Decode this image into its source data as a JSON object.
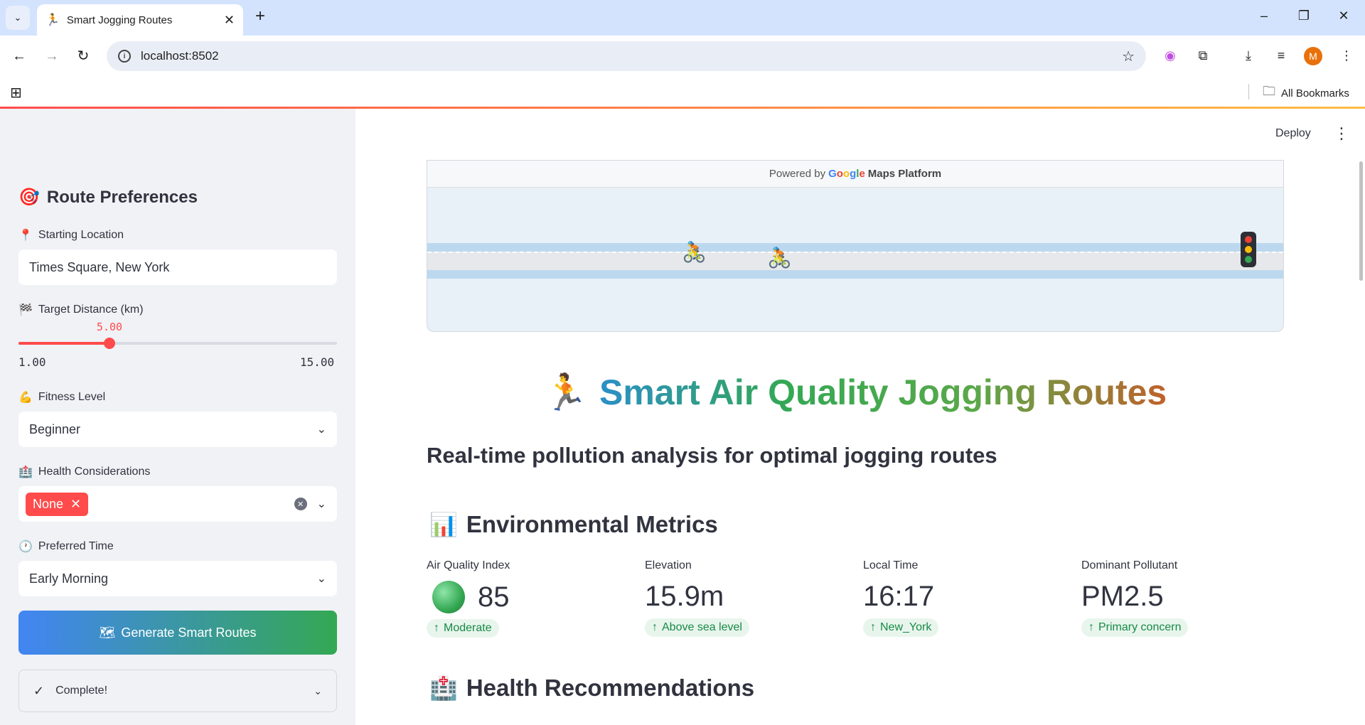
{
  "browser": {
    "tab_title": "Smart Jogging Routes",
    "url": "localhost:8502",
    "all_bookmarks": "All Bookmarks",
    "avatar_letter": "M"
  },
  "sidebar": {
    "heading": "Route Preferences",
    "starting_location": {
      "label": "Starting Location",
      "value": "Times Square, New York"
    },
    "target_distance": {
      "label": "Target Distance (km)",
      "value": "5.00",
      "min": "1.00",
      "max": "15.00",
      "fraction": 0.2857
    },
    "fitness_level": {
      "label": "Fitness Level",
      "value": "Beginner"
    },
    "health": {
      "label": "Health Considerations",
      "tag": "None"
    },
    "preferred_time": {
      "label": "Preferred Time",
      "value": "Early Morning"
    },
    "generate_button": "Generate Smart Routes",
    "status": "Complete!"
  },
  "main": {
    "deploy": "Deploy",
    "map": {
      "powered_prefix": "Powered by",
      "brand_letters": [
        "G",
        "o",
        "o",
        "g",
        "l",
        "e"
      ],
      "brand_colors": [
        "#4285f4",
        "#ea4335",
        "#fbbc05",
        "#4285f4",
        "#34a853",
        "#ea4335"
      ],
      "platform": "Maps Platform"
    },
    "title": "Smart Air Quality Jogging Routes",
    "subtitle": "Real-time pollution analysis for optimal jogging routes",
    "env_section": "Environmental Metrics",
    "metrics": [
      {
        "label": "Air Quality Index",
        "value": "85",
        "delta": "Moderate"
      },
      {
        "label": "Elevation",
        "value": "15.9m",
        "delta": "Above sea level"
      },
      {
        "label": "Local Time",
        "value": "16:17",
        "delta": "New_York"
      },
      {
        "label": "Dominant Pollutant",
        "value": "PM2.5",
        "delta": "Primary concern"
      }
    ],
    "health_section": "Health Recommendations"
  }
}
